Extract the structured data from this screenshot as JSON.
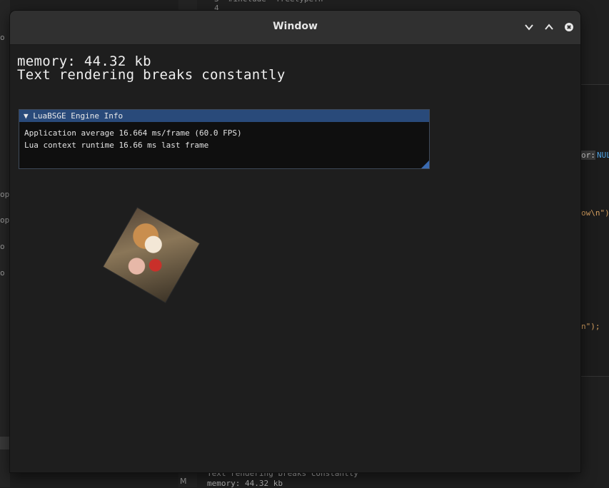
{
  "background": {
    "top_code": "3  #include \"freetype.h\"\n4",
    "right_fragments": {
      "frag1": "or:",
      "frag2": "NUL",
      "frag3": "ow\\n\")",
      "frag4": "n\");"
    },
    "left_fragments": [
      "o",
      "op",
      "op",
      "o",
      "o"
    ],
    "gutter_marker": "M",
    "terminal": {
      "line1": "Text rendering breaks constantly",
      "line2": "memory: 44.32 kb"
    }
  },
  "window": {
    "title": "Window",
    "controls": {
      "minimize": "chevron-down-icon",
      "maximize": "chevron-up-icon",
      "close": "close-icon"
    }
  },
  "overlay": {
    "memory_line": "memory: 44.32 kb",
    "status_line": "Text rendering breaks constantly"
  },
  "engine_info": {
    "header": "▼ LuaBSGE Engine Info",
    "app_avg": "Application average 16.664 ms/frame (60.0 FPS)",
    "lua_runtime": "Lua context runtime 16.66 ms last frame"
  },
  "image": {
    "subject": "fox-photo"
  }
}
